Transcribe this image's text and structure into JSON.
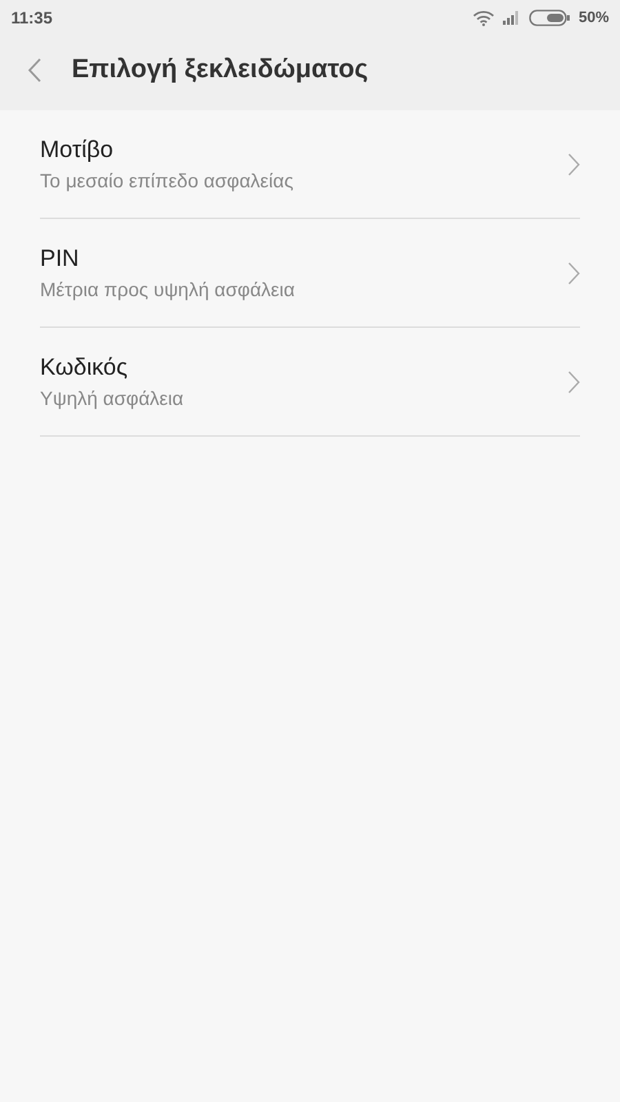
{
  "status_bar": {
    "time": "11:35",
    "battery": "50%"
  },
  "header": {
    "title": "Επιλογή ξεκλειδώματος"
  },
  "options": [
    {
      "title": "Μοτίβο",
      "subtitle": "Το μεσαίο επίπεδο ασφαλείας"
    },
    {
      "title": "PIN",
      "subtitle": "Μέτρια προς υψηλή ασφάλεια"
    },
    {
      "title": "Κωδικός",
      "subtitle": "Υψηλή ασφάλεια"
    }
  ]
}
